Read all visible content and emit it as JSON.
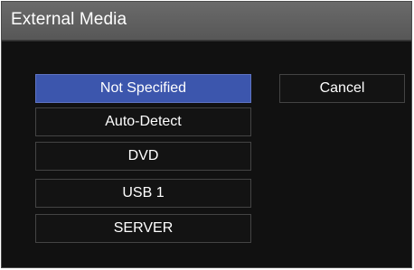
{
  "dialog": {
    "title": "External Media",
    "options": [
      {
        "label": "Not Specified",
        "selected": true
      },
      {
        "label": "Auto-Detect",
        "selected": false
      },
      {
        "label": "DVD",
        "selected": false
      },
      {
        "label": "USB 1",
        "selected": false
      },
      {
        "label": "SERVER",
        "selected": false
      }
    ],
    "cancel_label": "Cancel"
  },
  "colors": {
    "selected": "#3c56ad",
    "background": "#111111",
    "title_bar": "#616161"
  }
}
